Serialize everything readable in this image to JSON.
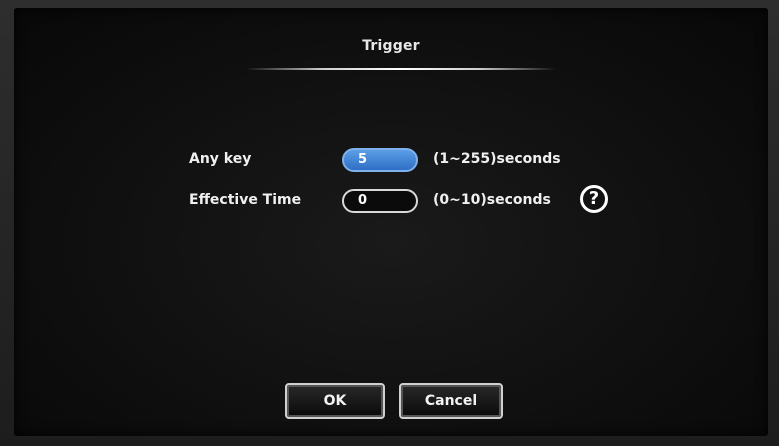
{
  "dialog": {
    "title": "Trigger"
  },
  "rows": [
    {
      "label": "Any key",
      "value": "5",
      "range": "(1~255)seconds"
    },
    {
      "label": "Effective Time",
      "value": "0",
      "range": "(0~10)seconds"
    }
  ],
  "help_icon": {
    "glyph": "?",
    "icon": "help-icon"
  },
  "buttons": {
    "ok": "OK",
    "cancel": "Cancel"
  },
  "colors": {
    "active_field": "#3d7fd6",
    "background": "#0d0d0d",
    "text": "#f0f0f0"
  }
}
